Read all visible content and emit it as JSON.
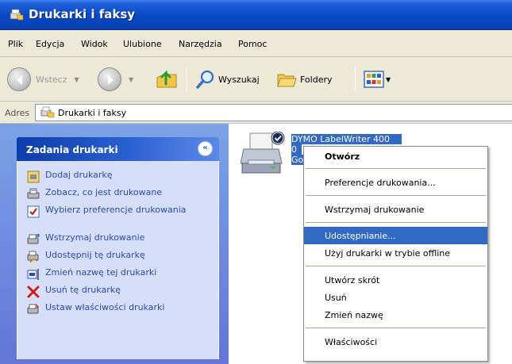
{
  "window": {
    "title": "Drukarki i faksy"
  },
  "menubar": {
    "items": [
      "Plik",
      "Edycja",
      "Widok",
      "Ulubione",
      "Narzędzia",
      "Pomoc"
    ]
  },
  "toolbar": {
    "back_label": "Wstecz",
    "search_label": "Wyszukaj",
    "folders_label": "Foldery"
  },
  "address": {
    "label": "Adres",
    "value": "Drukarki i faksy"
  },
  "taskpane": {
    "title": "Zadania drukarki",
    "items": [
      {
        "label": "Dodaj drukarkę",
        "icon": "add-printer-icon"
      },
      {
        "label": "Zobacz, co jest drukowane",
        "icon": "print-queue-icon"
      },
      {
        "label": "Wybierz preferencje drukowania",
        "icon": "preferences-icon"
      },
      {
        "label": "Wstrzymaj drukowanie",
        "icon": "pause-printer-icon"
      },
      {
        "label": "Udostępnij tę drukarkę",
        "icon": "share-printer-icon"
      },
      {
        "label": "Zmień nazwę tej drukarki",
        "icon": "rename-icon"
      },
      {
        "label": "Usuń tę drukarkę",
        "icon": "delete-icon"
      },
      {
        "label": "Ustaw właściwości drukarki",
        "icon": "properties-icon"
      }
    ]
  },
  "printer": {
    "name": "DYMO LabelWriter 400",
    "jobs": "0",
    "status": "Got"
  },
  "context_menu": {
    "items": [
      {
        "label": "Otwórz",
        "bold": true
      },
      {
        "label": "Preferencje drukowania..."
      },
      {
        "label": "Wstrzymaj drukowanie"
      },
      {
        "label": "Udostępnianie...",
        "highlighted": true
      },
      {
        "label": "Użyj drukarki w trybie offline"
      },
      {
        "label": "Utwórz skrót"
      },
      {
        "label": "Usuń"
      },
      {
        "label": "Zmień nazwę"
      },
      {
        "label": "Właściwości"
      }
    ]
  },
  "colors": {
    "titlebar": "#0a4ac6",
    "highlight": "#316ac5",
    "taskpane_link": "#2a4ab5",
    "delete_red": "#d11a1a"
  }
}
